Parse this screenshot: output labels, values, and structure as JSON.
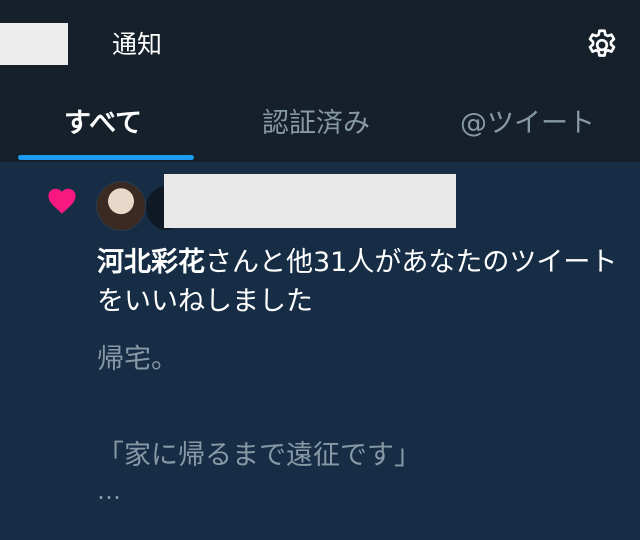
{
  "header": {
    "title": "通知",
    "settings_icon": "gear-icon"
  },
  "tabs": [
    {
      "label": "すべて",
      "active": true
    },
    {
      "label": "認証済み",
      "active": false
    },
    {
      "label": "@ツイート",
      "active": false
    }
  ],
  "notification": {
    "icon": "heart-icon",
    "icon_color": "#f91880",
    "actor_name": "河北彩花",
    "message_rest": "さんと他31人があなたのツイートをいいねしました",
    "tweet_lines": [
      "帰宅。",
      "",
      "「家に帰るまで遠征です」",
      "…"
    ]
  },
  "colors": {
    "background": "#15202b",
    "feed_background": "#162d45",
    "accent": "#1d9bf0",
    "muted_text": "#8899a6"
  }
}
